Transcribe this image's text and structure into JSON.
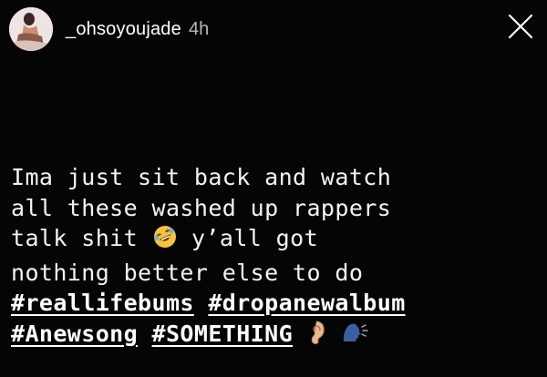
{
  "story": {
    "username": "_ohsoyoujade",
    "time_ago": "4h",
    "close_icon": "close-icon",
    "avatar_icon": "profile-photo-avatar"
  },
  "caption": {
    "line1": "Ima just sit back and watch",
    "line2": "all these washed up rappers",
    "line3_text": "talk shit",
    "line3_emoji": "rolling-on-floor-laughing-emoji",
    "line3_rest": "y’all got",
    "line4": "nothing better else to do",
    "hashtags": [
      "#reallifebums",
      "#dropanewalbum",
      "#Anewsong",
      "#SOMETHING"
    ],
    "end_emojis": [
      "ear-emoji",
      "speaking-head-emoji"
    ]
  },
  "colors": {
    "background": "#050505",
    "text": "#f4f4f4",
    "time": "#b8b8b8"
  }
}
